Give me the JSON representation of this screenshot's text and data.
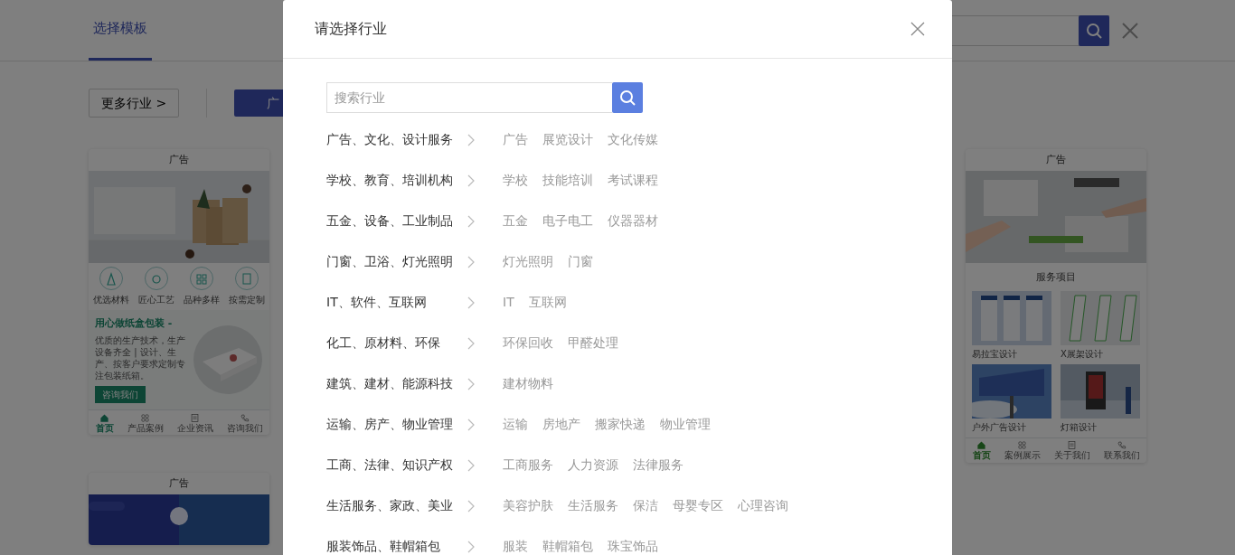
{
  "header": {
    "tabs": [
      {
        "label": "选择模板",
        "selected": true
      }
    ]
  },
  "toolbar": {
    "more_button": "更多行业 >",
    "industry_buttons": [
      {
        "label": "广",
        "selected": true
      }
    ]
  },
  "templates": [
    {
      "kind": "product",
      "title": "广告",
      "features": [
        "优选材料",
        "匠心工艺",
        "品种多样",
        "按需定制"
      ],
      "section": {
        "heading": "用心做纸盒包装 -",
        "text": "优质的生产技术，生产设备齐全 | 设计、生产、按客户要求定制专注包装纸箱。",
        "button": "咨询我们"
      },
      "nav": [
        {
          "label": "首页",
          "selected": true
        },
        {
          "label": "产品案例",
          "selected": false
        },
        {
          "label": "企业资讯",
          "selected": false
        },
        {
          "label": "咨询我们",
          "selected": false
        }
      ]
    },
    {
      "kind": "service",
      "title": "广告",
      "heading": "服务项目",
      "items": [
        {
          "label": "易拉宝设计"
        },
        {
          "label": "X展架设计"
        },
        {
          "label": "户外广告设计"
        },
        {
          "label": "灯箱设计"
        }
      ],
      "nav": [
        {
          "label": "首页",
          "selected": true
        },
        {
          "label": "案例展示",
          "selected": false
        },
        {
          "label": "关于我们",
          "selected": false
        },
        {
          "label": "联系我们",
          "selected": false
        }
      ]
    },
    {
      "kind": "partial",
      "title": "广告"
    }
  ],
  "modal": {
    "title": "请选择行业",
    "search": {
      "placeholder": "搜索行业"
    },
    "industries": [
      {
        "name": "广告、文化、设计服务",
        "tags": [
          "广告",
          "展览设计",
          "文化传媒"
        ]
      },
      {
        "name": "学校、教育、培训机构",
        "tags": [
          "学校",
          "技能培训",
          "考试课程"
        ]
      },
      {
        "name": "五金、设备、工业制品",
        "tags": [
          "五金",
          "电子电工",
          "仪器器材"
        ]
      },
      {
        "name": "门窗、卫浴、灯光照明",
        "tags": [
          "灯光照明",
          "门窗"
        ]
      },
      {
        "name": "IT、软件、互联网",
        "tags": [
          "IT",
          "互联网"
        ]
      },
      {
        "name": "化工、原材料、环保",
        "tags": [
          "环保回收",
          "甲醛处理"
        ]
      },
      {
        "name": "建筑、建材、能源科技",
        "tags": [
          "建材物料"
        ]
      },
      {
        "name": "运输、房产、物业管理",
        "tags": [
          "运输",
          "房地产",
          "搬家快递",
          "物业管理"
        ]
      },
      {
        "name": "工商、法律、知识产权",
        "tags": [
          "工商服务",
          "人力资源",
          "法律服务"
        ]
      },
      {
        "name": "生活服务、家政、美业",
        "tags": [
          "美容护肤",
          "生活服务",
          "保洁",
          "母婴专区",
          "心理咨询"
        ]
      },
      {
        "name": "服装饰品、鞋帽箱包",
        "tags": [
          "服装",
          "鞋帽箱包",
          "珠宝饰品"
        ]
      }
    ]
  }
}
